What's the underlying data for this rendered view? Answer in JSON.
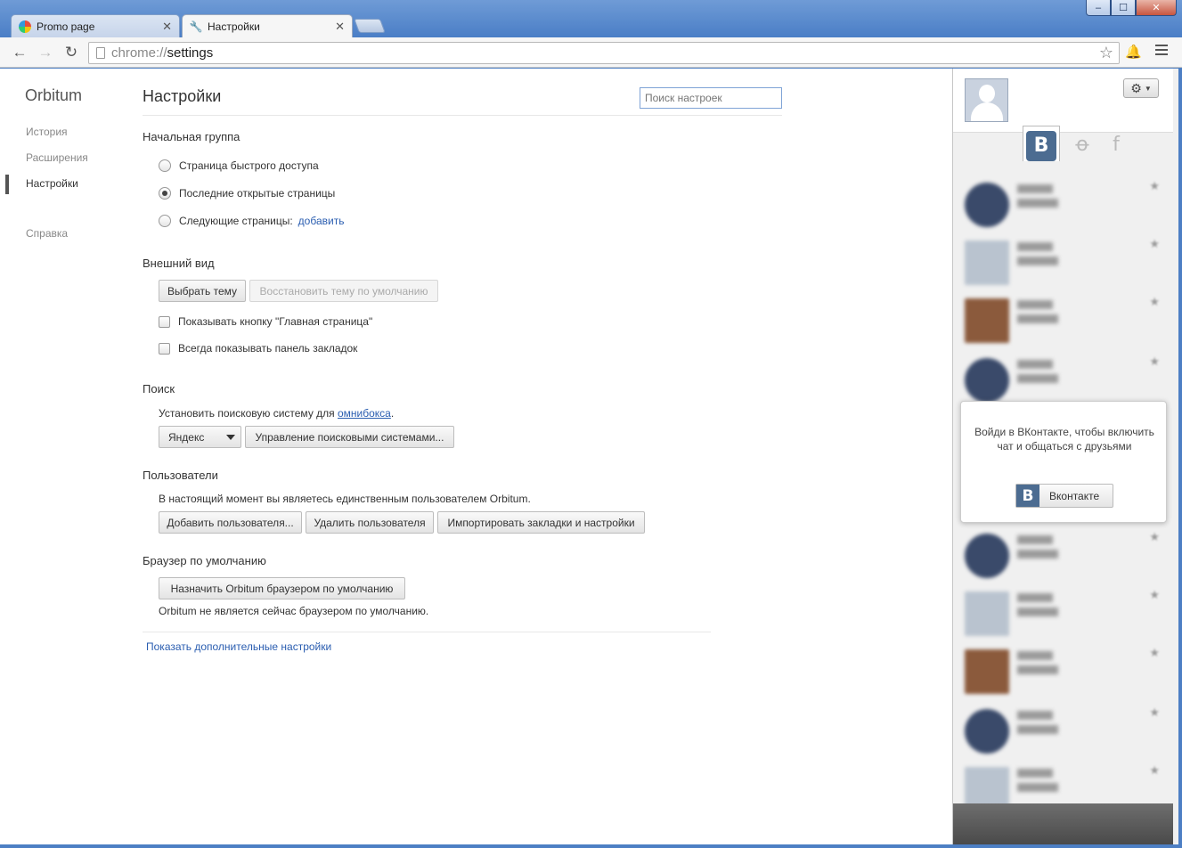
{
  "tabs": [
    {
      "title": "Promo page",
      "icon": "orbitum-favicon"
    },
    {
      "title": "Настройки",
      "icon": "wrench-icon",
      "active": true
    }
  ],
  "window": {
    "minimize": "‒",
    "maximize": "☐",
    "close": "✕"
  },
  "toolbar": {
    "url_scheme": "chrome://",
    "url_path": "settings"
  },
  "nav": {
    "brand": "Orbitum",
    "items": [
      "История",
      "Расширения",
      "Настройки",
      "Справка"
    ]
  },
  "settings": {
    "title": "Настройки",
    "search_placeholder": "Поиск настроек",
    "startup": {
      "title": "Начальная группа",
      "options": [
        "Страница быстрого доступа",
        "Последние открытые страницы",
        "Следующие страницы:"
      ],
      "selected_index": 1,
      "add_link": "добавить"
    },
    "appearance": {
      "title": "Внешний вид",
      "choose_theme": "Выбрать тему",
      "reset_theme": "Восстановить тему по умолчанию",
      "show_home": "Показывать кнопку \"Главная страница\"",
      "show_bookmarks": "Всегда показывать панель закладок"
    },
    "search": {
      "title": "Поиск",
      "desc_prefix": "Установить поисковую систему для ",
      "desc_link": "омнибокса",
      "desc_suffix": ".",
      "engine": "Яндекс",
      "manage": "Управление поисковыми системами..."
    },
    "users": {
      "title": "Пользователи",
      "desc": "В настоящий момент вы являетесь единственным пользователем Orbitum.",
      "add": "Добавить пользователя...",
      "remove": "Удалить пользователя",
      "import": "Импортировать закладки и настройки"
    },
    "default_browser": {
      "title": "Браузер по умолчанию",
      "make_default": "Назначить Orbitum браузером по умолчанию",
      "status": "Orbitum не является сейчас браузером по умолчанию."
    },
    "show_advanced": "Показать дополнительные настройки"
  },
  "sidebar": {
    "vk_letter": "В",
    "ok_glyph": "ꝋ",
    "fb_glyph": "f",
    "popup_text": "Войди в ВКонтакте, чтобы включить чат и общаться с друзьями",
    "popup_button": "Вконтакте",
    "friends": [
      {
        "avatar_color": "#3a4a6a",
        "shape": "round"
      },
      {
        "avatar_color": "#b9c3cf",
        "shape": "square"
      },
      {
        "avatar_color": "#8b5a3c",
        "shape": "square"
      },
      {
        "avatar_color": "#3a4a6a",
        "shape": "round"
      },
      {
        "avatar_color": "#3a4a6a",
        "shape": "round"
      },
      {
        "avatar_color": "#b9c3cf",
        "shape": "square"
      },
      {
        "avatar_color": "#8b5a3c",
        "shape": "square"
      },
      {
        "avatar_color": "#3a4a6a",
        "shape": "round"
      },
      {
        "avatar_color": "#b9c3cf",
        "shape": "square"
      }
    ]
  }
}
